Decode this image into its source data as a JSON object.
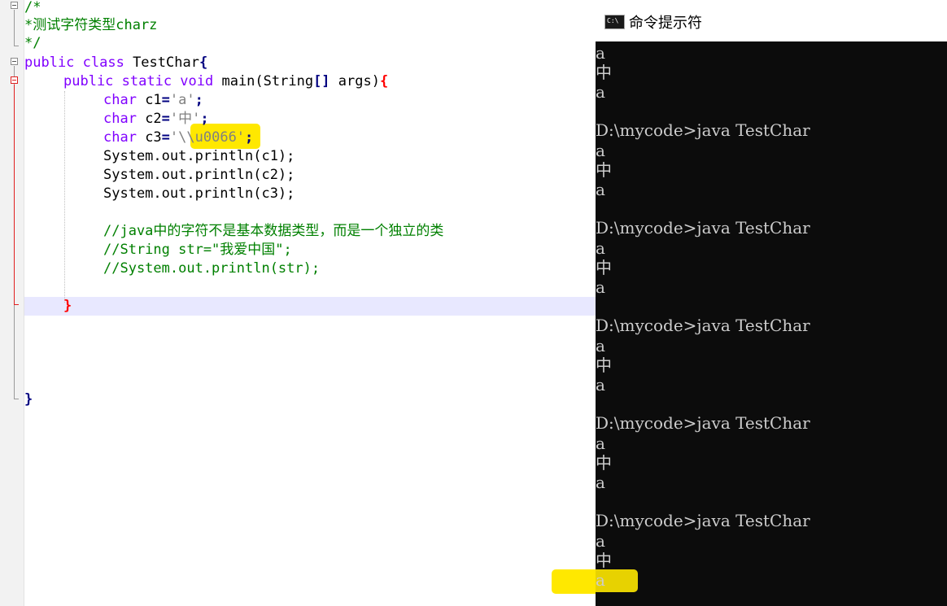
{
  "editor": {
    "comment_open": "/*",
    "comment_text": "*测试字符类型charz",
    "comment_close": "*/",
    "class_kw": "public class",
    "class_name": " TestChar",
    "class_brace": "{",
    "main_kw": "public static void",
    "main_sig": " main(String",
    "main_brackets": "[]",
    "main_args": " args)",
    "main_brace": "{",
    "char_kw": "char",
    "c1_name": " c1",
    "c1_value": "'a'",
    "c2_name": " c2",
    "c2_value": "'中'",
    "c3_name": " c3",
    "c3_value": "'\\\\u0066'",
    "assign": "=",
    "semi": ";",
    "println_c1": "System.out.println(c1);",
    "println_c2": "System.out.println(c2);",
    "println_c3": "System.out.println(c3);",
    "comment_1": "//java中的字符不是基本数据类型，而是一个独立的类",
    "comment_2": "//String str=\"我爱中国\";",
    "comment_3": "//System.out.println(str);",
    "method_close": "}",
    "class_close": "}"
  },
  "cmd": {
    "title": "命令提示符",
    "icon_text": "C:\\",
    "prompt": "D:\\mycode>java TestChar",
    "out_a": "a",
    "out_zh": "中",
    "blocks": 6
  },
  "colors": {
    "keyword": "#8000ff",
    "comment": "#008000",
    "string": "#808080",
    "highlight": "#ffe800",
    "console_bg": "#0c0c0c",
    "console_fg": "#cccccc"
  }
}
